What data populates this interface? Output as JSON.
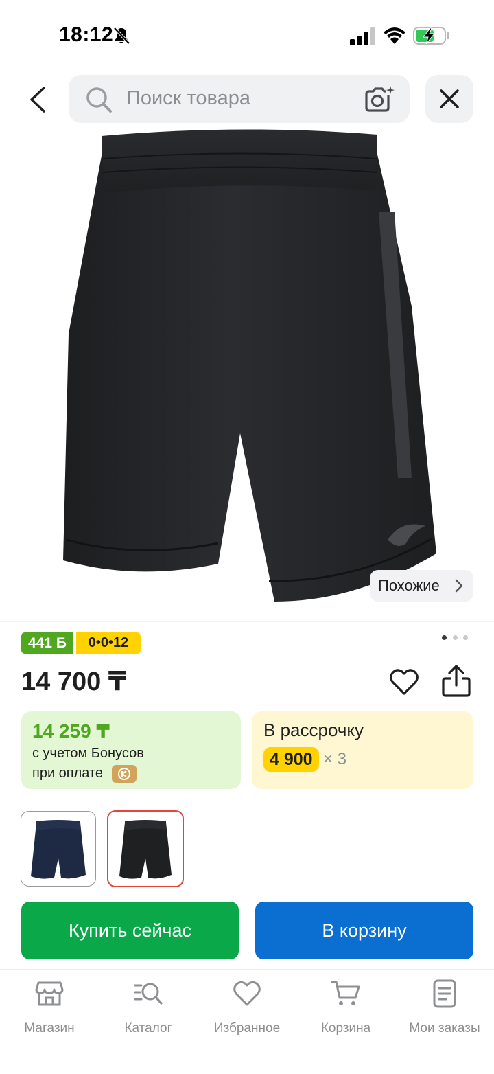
{
  "status_bar": {
    "time": "18:12"
  },
  "search": {
    "placeholder": "Поиск товара"
  },
  "product": {
    "similar_label": "Похожие",
    "bonus_badge": "441 Б",
    "installment_badge": "0•0•12",
    "price": "14 700 ₸",
    "bonus_card": {
      "price": "14 259 ₸",
      "line1": "с учетом Бонусов",
      "line2": "при оплате"
    },
    "installment_card": {
      "title": "В рассрочку",
      "amount": "4 900",
      "times": "× 3"
    }
  },
  "actions": {
    "buy_now": "Купить сейчас",
    "add_to_cart": "В корзину"
  },
  "bottom_nav": {
    "items": [
      {
        "label": "Магазин",
        "icon": "shop-icon"
      },
      {
        "label": "Каталог",
        "icon": "catalog-icon"
      },
      {
        "label": "Избранное",
        "icon": "heart-icon"
      },
      {
        "label": "Корзина",
        "icon": "cart-icon"
      },
      {
        "label": "Мои заказы",
        "icon": "orders-icon"
      }
    ]
  },
  "colors": {
    "buy_now": "#0ba84a",
    "cart": "#0a6fd1",
    "bonus_green": "#4fa81f",
    "installment_yellow": "#ffd200",
    "selected_variant_border": "#e0463a"
  }
}
